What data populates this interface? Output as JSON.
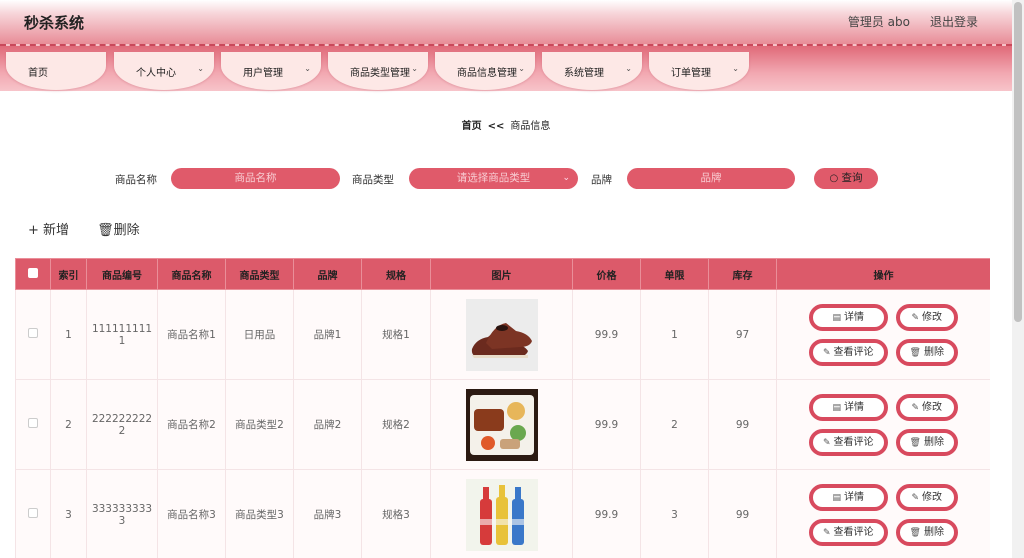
{
  "header": {
    "title": "秒杀系统",
    "user": "管理员 abo",
    "logout": "退出登录"
  },
  "nav": [
    {
      "label": "首页",
      "chevron": false
    },
    {
      "label": "个人中心",
      "chevron": true
    },
    {
      "label": "用户管理",
      "chevron": true
    },
    {
      "label": "商品类型管理",
      "chevron": true
    },
    {
      "label": "商品信息管理",
      "chevron": true
    },
    {
      "label": "系统管理",
      "chevron": true
    },
    {
      "label": "订单管理",
      "chevron": true
    }
  ],
  "breadcrumb": {
    "home": "首页",
    "separator": "<<",
    "current": "商品信息"
  },
  "search": {
    "name_label": "商品名称",
    "name_placeholder": "商品名称",
    "type_label": "商品类型",
    "type_placeholder": "请选择商品类型",
    "brand_label": "品牌",
    "brand_placeholder": "品牌",
    "query_label": "查询"
  },
  "actions": {
    "add": "新增",
    "delete": "删除"
  },
  "table": {
    "headers": [
      "",
      "索引",
      "商品编号",
      "商品名称",
      "商品类型",
      "品牌",
      "规格",
      "图片",
      "价格",
      "单限",
      "库存",
      "操作"
    ],
    "rows": [
      {
        "index": "1",
        "code_line1": "111111111",
        "code_line2": "1",
        "name": "商品名称1",
        "type": "日用品",
        "brand": "品牌1",
        "spec": "规格1",
        "image": "brown-leather-shoes",
        "price": "99.9",
        "limit": "1",
        "stock": "97"
      },
      {
        "index": "2",
        "code_line1": "222222222",
        "code_line2": "2",
        "name": "商品名称2",
        "type": "商品类型2",
        "brand": "品牌2",
        "spec": "规格2",
        "image": "bento-box-food",
        "price": "99.9",
        "limit": "2",
        "stock": "99"
      },
      {
        "index": "3",
        "code_line1": "333333333",
        "code_line2": "3",
        "name": "商品名称3",
        "type": "商品类型3",
        "brand": "品牌3",
        "spec": "规格3",
        "image": "three-bottles",
        "price": "99.9",
        "limit": "3",
        "stock": "99"
      }
    ],
    "ops": {
      "detail": "详情",
      "edit": "修改",
      "comments": "查看评论",
      "delete": "删除"
    }
  },
  "colors": {
    "accent": "#dc5a6a",
    "nav_item_bg": "#fde8e6"
  }
}
